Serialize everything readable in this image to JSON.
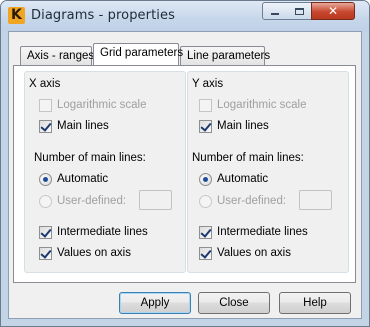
{
  "window": {
    "title": "Diagrams - properties",
    "app_icon_letter": "K",
    "controls": {
      "close_glyph": "✕"
    }
  },
  "tabs": [
    {
      "label": "Axis - ranges",
      "active": false
    },
    {
      "label": "Grid parameters",
      "active": true
    },
    {
      "label": "Line parameters",
      "active": false
    }
  ],
  "x_axis": {
    "heading": "X axis",
    "logarithmic": {
      "label": "Logarithmic scale",
      "checked": false,
      "enabled": false
    },
    "main_lines": {
      "label": "Main lines",
      "checked": true
    },
    "number_heading": "Number of main lines:",
    "automatic": {
      "label": "Automatic",
      "selected": true
    },
    "user_defined": {
      "label": "User-defined:",
      "selected": false,
      "enabled": false,
      "value": ""
    },
    "intermediate": {
      "label": "Intermediate lines",
      "checked": true
    },
    "values_on_axis": {
      "label": "Values on axis",
      "checked": true
    }
  },
  "y_axis": {
    "heading": "Y axis",
    "logarithmic": {
      "label": "Logarithmic scale",
      "checked": false,
      "enabled": false
    },
    "main_lines": {
      "label": "Main lines",
      "checked": true
    },
    "number_heading": "Number of main lines:",
    "automatic": {
      "label": "Automatic",
      "selected": true
    },
    "user_defined": {
      "label": "User-defined:",
      "selected": false,
      "enabled": false,
      "value": ""
    },
    "intermediate": {
      "label": "Intermediate lines",
      "checked": true
    },
    "values_on_axis": {
      "label": "Values on axis",
      "checked": true
    }
  },
  "buttons": {
    "apply": "Apply",
    "close": "Close",
    "help": "Help"
  }
}
